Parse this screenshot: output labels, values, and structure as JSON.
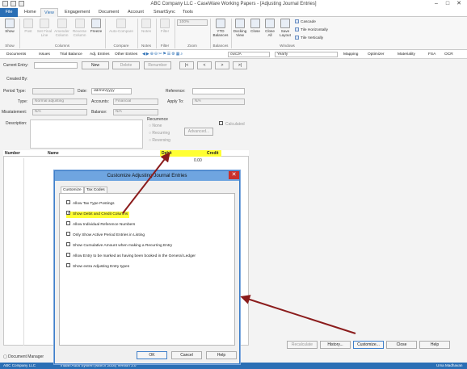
{
  "window": {
    "title": "ABC Company LLC - CaseWare Working Papers - [Adjusting Journal Entries]"
  },
  "ribbon_tabs": [
    "File",
    "Home",
    "View",
    "Engagement",
    "Document",
    "Account",
    "SmartSync",
    "Tools"
  ],
  "ribbon": {
    "show": "Show",
    "columns": [
      "Post",
      "Set Final Line",
      "Amender Column",
      "Reverse Column",
      "Freeze"
    ],
    "compare": "Auto-Compare",
    "notes": "Notes",
    "filter": "Filter",
    "zoom_value": "100%",
    "balances": "YTD Balances",
    "docking": [
      "Docking View",
      "Close",
      "Close All",
      "Save Layout"
    ],
    "windows": [
      "Cascade",
      "Tile Horizontally",
      "Tile Vertically"
    ],
    "group_labels": [
      "Show",
      "Columns",
      "Compare",
      "Notes",
      "Filter",
      "Zoom",
      "Balances",
      "Windows"
    ]
  },
  "nav": {
    "items": [
      "Documents",
      "Issues",
      "Trial Balance",
      "Adj. Entries",
      "Other Entries"
    ],
    "entity": "cwcJA",
    "period": "Yearly",
    "right_items": [
      "Mapping",
      "Optimizer",
      "Materiality",
      "FSA",
      "OCR"
    ]
  },
  "entry_bar": {
    "current_label": "Current Entry:",
    "new": "New",
    "delete": "Delete",
    "renumber": "Renumber",
    "first": "|<",
    "prev": "<",
    "next": ">",
    "last": ">|"
  },
  "form": {
    "created_by": "Created By:",
    "period_type": "Period Type:",
    "date_label": "Date:",
    "date_value": "dd/mm/yyyy",
    "reference": "Reference:",
    "type_label": "Type:",
    "type_value": "Normal adjusting",
    "accounts_label": "Accounts:",
    "accounts_value": "Financial",
    "apply_to_label": "Apply To:",
    "apply_to_value": "N/A",
    "misstatement_label": "Misstatement:",
    "misstatement_value": "N/A",
    "balance_label": "Balance:",
    "balance_value": "N/A",
    "description": "Description:",
    "recurrence": "Recurrence",
    "rec_none": "None",
    "rec_recurring": "Recurring",
    "rec_reversing": "Reversing",
    "advanced": "Advanced...",
    "calculated": "Calculated"
  },
  "grid": {
    "headers": [
      "Number",
      "Name",
      "Debit",
      "Credit"
    ],
    "zero": "0.00"
  },
  "dialog": {
    "title": "Customize Adjusting Journal Entries",
    "close": "✕",
    "tabs": [
      "Customize",
      "Tax Codes"
    ],
    "options": [
      {
        "label": "Allow Tax Type Postings",
        "checked": false
      },
      {
        "label": "Show Debit and Credit Columns",
        "checked": true
      },
      {
        "label": "Allow Individual Reference Numbers",
        "checked": false
      },
      {
        "label": "Only Show Active Period Entries in Listing",
        "checked": false
      },
      {
        "label": "Show Cumulative Amount when making a Recurring Entry",
        "checked": false
      },
      {
        "label": "Allow Entry to be marked as having been booked in the General Ledger",
        "checked": false
      },
      {
        "label": "Show extra Adjusting Entry types",
        "checked": false
      }
    ],
    "ok": "OK",
    "cancel": "Cancel",
    "help": "Help"
  },
  "bottom_buttons": [
    "Recalculate",
    "History...",
    "Customize...",
    "Close",
    "Help"
  ],
  "doc_manager": "Document Manager",
  "status": {
    "left": "ABC Company LLC",
    "mid": "Indian Audit System (March 2016) Version 3.0",
    "right": "Uma Madhavan"
  },
  "colors": {
    "accent": "#2b6fb5",
    "highlight": "#ffff33",
    "arrow": "#8b1c1c"
  }
}
